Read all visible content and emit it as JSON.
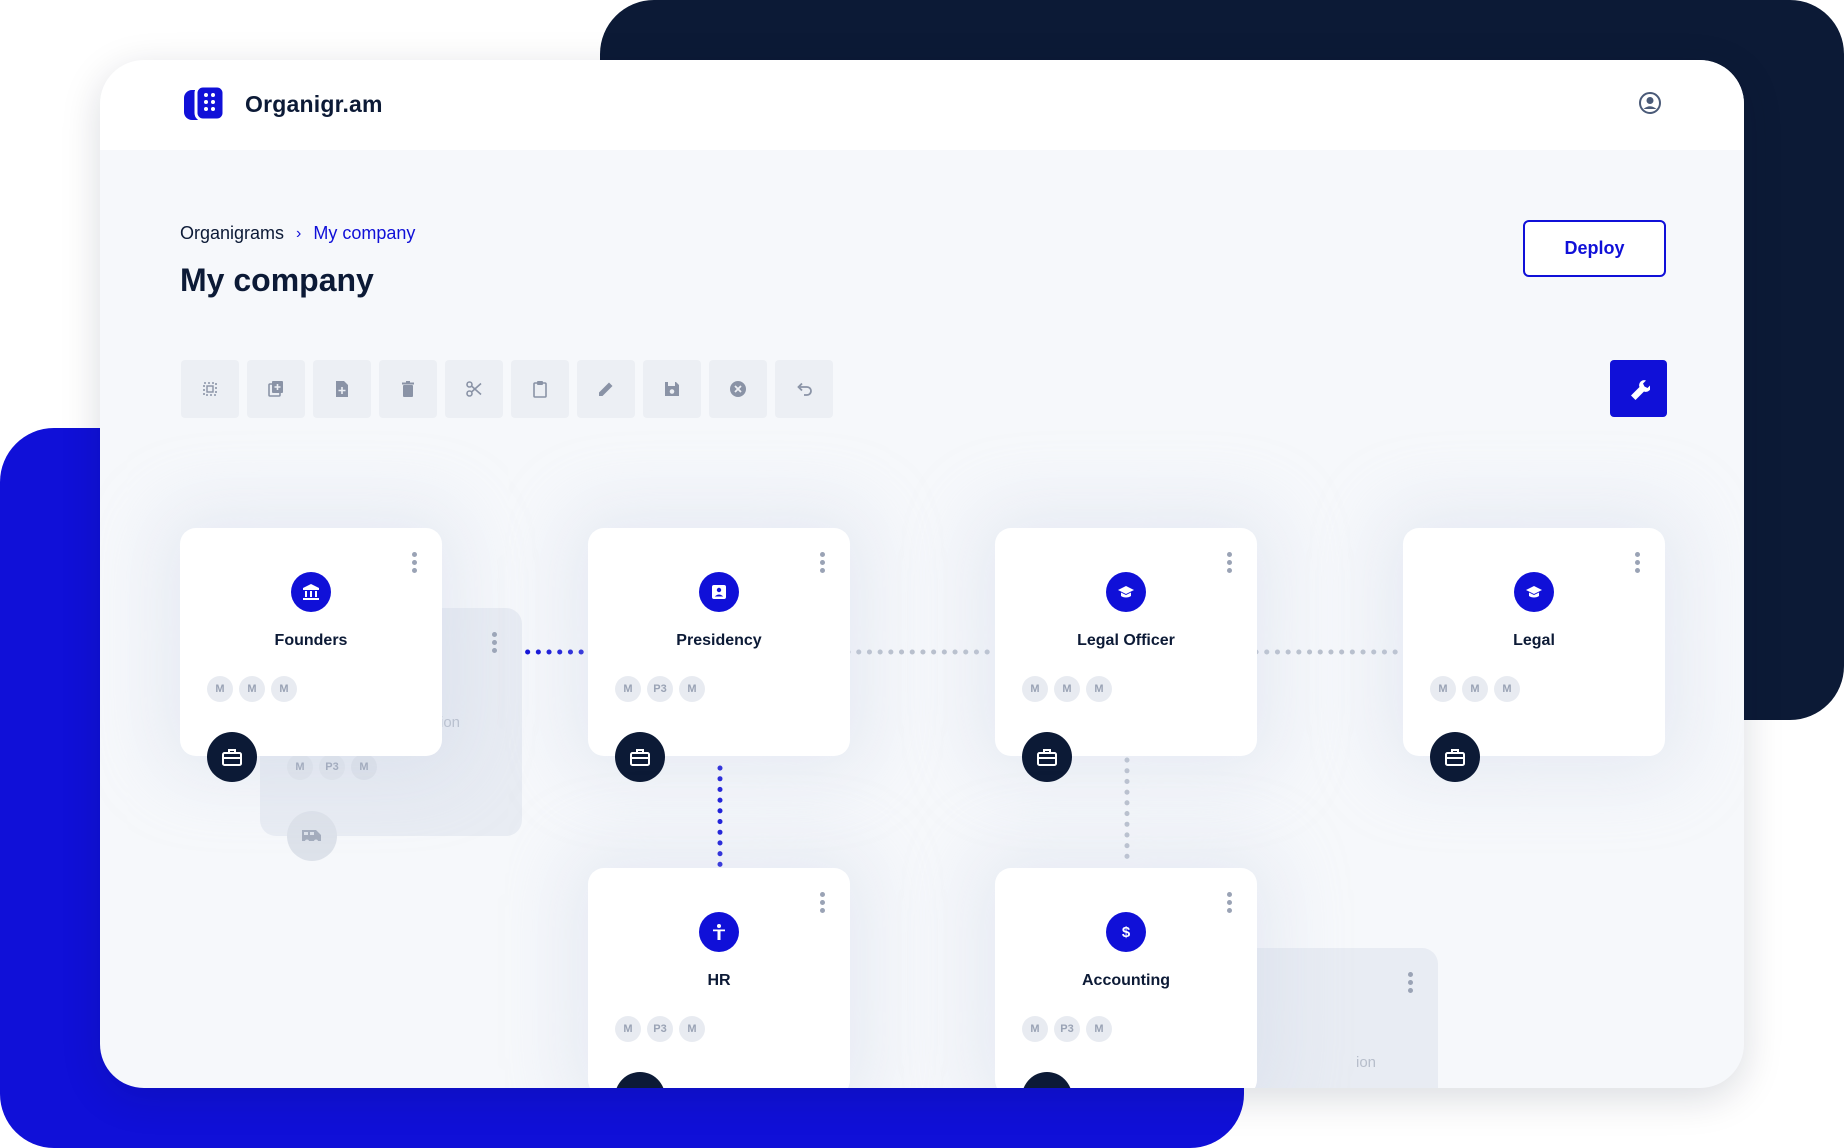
{
  "colors": {
    "accent": "#1010d8",
    "dark": "#0c1a36",
    "bg": "#f6f8fb"
  },
  "app": {
    "name": "Organigr.am"
  },
  "breadcrumb": {
    "root": "Organigrams",
    "separator": "›",
    "current": "My company"
  },
  "page": {
    "title": "My company"
  },
  "actions": {
    "deploy_label": "Deploy"
  },
  "toolbar": {
    "tools": [
      "select-icon",
      "duplicate-icon",
      "add-file-icon",
      "delete-icon",
      "cut-icon",
      "paste-icon",
      "edit-icon",
      "save-icon",
      "cancel-icon",
      "undo-icon"
    ],
    "settings_icon": "wrench-icon"
  },
  "nodes": [
    {
      "title": "Founders",
      "icon": "bank-icon",
      "badges": [
        "M",
        "M",
        "M"
      ]
    },
    {
      "title": "Presidency",
      "icon": "contact-card-icon",
      "badges": [
        "M",
        "P3",
        "M"
      ]
    },
    {
      "title": "Legal Officer",
      "icon": "graduation-cap-icon",
      "badges": [
        "M",
        "M",
        "M"
      ]
    },
    {
      "title": "Legal",
      "icon": "graduation-cap-icon",
      "badges": [
        "M",
        "M",
        "M"
      ]
    },
    {
      "title": "HR",
      "icon": "accessibility-icon",
      "badges": [
        "M",
        "P3",
        "M"
      ]
    },
    {
      "title": "Accounting",
      "icon": "dollar-icon",
      "badges": [
        "M",
        "P3",
        "M"
      ]
    }
  ],
  "ghost_nodes": [
    {
      "partial_label": "ion",
      "badges": [
        "M",
        "P3",
        "M"
      ]
    },
    {
      "partial_label": "ion"
    }
  ]
}
